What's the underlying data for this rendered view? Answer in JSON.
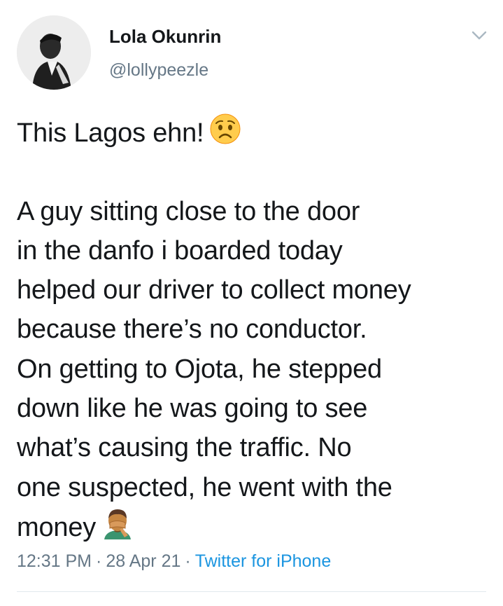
{
  "author": {
    "name": "Lola Okunrin",
    "handle": "@lollypeezle",
    "avatar_icon": "profile-photo"
  },
  "menu": {
    "icon": "chevron-down-icon"
  },
  "tweet": {
    "lines": [
      "This Lagos ehn!",
      "",
      "A guy sitting close to the door",
      "in the danfo i boarded today",
      "helped our driver to collect money",
      "because there’s no conductor.",
      "On getting to Ojota, he stepped",
      "down like he was going to see",
      "what’s causing the traffic. No",
      "one suspected, he went with the",
      "money"
    ],
    "emojis": [
      "worried-face-emoji",
      "facepalm-emoji"
    ]
  },
  "meta": {
    "time": "12:31 PM",
    "date": "28 Apr 21",
    "separator": "·",
    "source": "Twitter for iPhone"
  },
  "colors": {
    "text": "#14171a",
    "secondary": "#657786",
    "link": "#1b95e0",
    "divider": "#e1e8ed"
  }
}
